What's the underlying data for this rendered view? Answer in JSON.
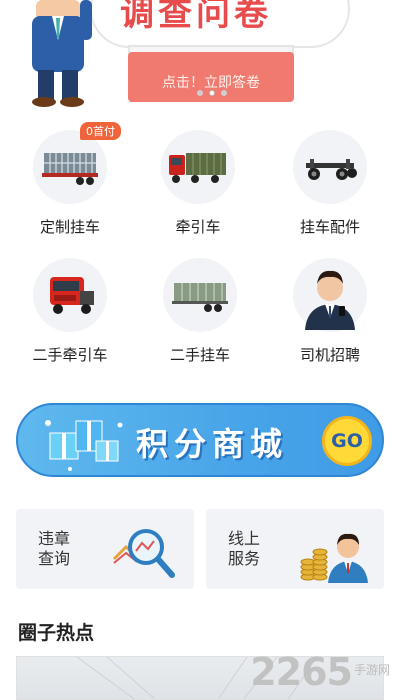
{
  "banner": {
    "title": "调查问卷",
    "cta": "点击！立即答卷",
    "dots": 3,
    "active_dot": 1
  },
  "categories": [
    {
      "label": "定制挂车",
      "badge": "0首付",
      "icon": "livestock-trailer-icon"
    },
    {
      "label": "牵引车",
      "icon": "red-truck-icon"
    },
    {
      "label": "挂车配件",
      "icon": "trailer-chassis-icon"
    },
    {
      "label": "二手牵引车",
      "icon": "tractor-head-icon"
    },
    {
      "label": "二手挂车",
      "icon": "fence-trailer-icon"
    },
    {
      "label": "司机招聘",
      "icon": "driver-portrait-icon"
    }
  ],
  "mall": {
    "title": "积分商城",
    "go_label": "GO"
  },
  "services": [
    {
      "line1": "违章",
      "line2": "查询",
      "icon": "magnifier-chart-icon"
    },
    {
      "line1": "线上",
      "line2": "服务",
      "icon": "service-agent-icon"
    }
  ],
  "section": {
    "title": "圈子热点"
  },
  "watermark": {
    "number": "2265",
    "sub": "手游网"
  },
  "colors": {
    "badge": "#f0643c",
    "mall_blue": "#4aa6e8",
    "go_yellow": "#ffd938",
    "card_bg": "#f1f3f6"
  }
}
